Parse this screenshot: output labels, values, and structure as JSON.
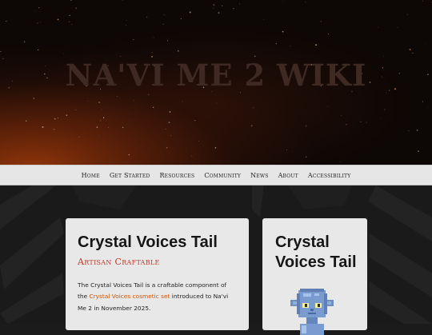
{
  "header": {
    "site_title": "NA'VI ME 2 WIKI"
  },
  "nav": {
    "items": [
      "Home",
      "Get Started",
      "Resources",
      "Community",
      "News",
      "About",
      "Accessibility"
    ]
  },
  "article": {
    "title": "Crystal Voices Tail",
    "subtitle": "Artisan Craftable",
    "para_1": "The Crystal Voices Tail is a craftable component of the ",
    "para_link": "Crystal Voices cosmetic set",
    "para_2": " introduced to Na'vi Me 2 in November 2025."
  },
  "infobox": {
    "title": "Crystal Voices Tail",
    "image_icon": "navi-avatar-sprite-icon"
  },
  "colors": {
    "accent_red": "#c0392b",
    "link_orange": "#d35400",
    "nav_bg": "#e6e6e6",
    "card_bg": "#e8e8e8"
  }
}
